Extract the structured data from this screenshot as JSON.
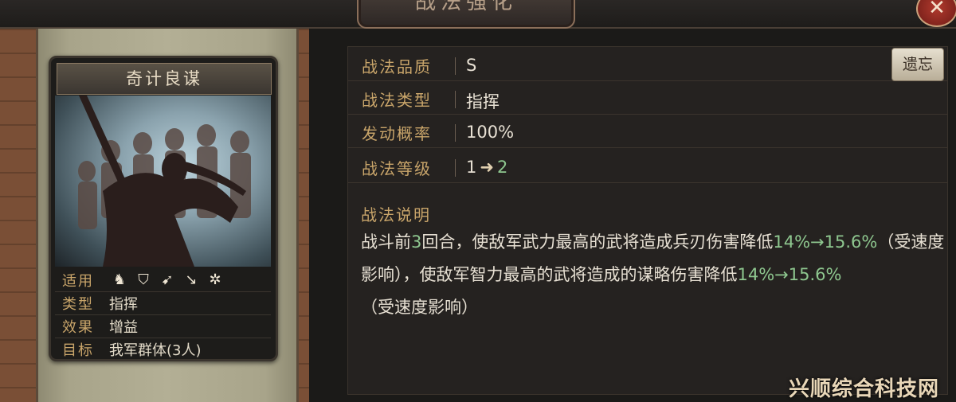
{
  "window": {
    "title": "战法强化"
  },
  "card": {
    "name": "奇计良谋",
    "attrs": {
      "suit_label": "适用",
      "type_label": "类型",
      "type_value": "指挥",
      "effect_label": "效果",
      "effect_value": "增益",
      "target_label": "目标",
      "target_value": "我军群体(3人)"
    },
    "unit_icons": [
      "cavalry-icon",
      "shield-icon",
      "bow-icon",
      "spear-icon",
      "wheel-icon"
    ]
  },
  "props": [
    {
      "key": "战法品质",
      "value": "S"
    },
    {
      "key": "战法类型",
      "value": "指挥"
    },
    {
      "key": "发动概率",
      "value": "100%"
    },
    {
      "key": "战法等级",
      "from": "1",
      "to": "2"
    }
  ],
  "reselect_label": "遗忘",
  "description": {
    "title": "战法说明",
    "p1": "战斗前",
    "n1": "3",
    "p2": "回合，使敌军武力最高的武将造成兵刃伤害降低",
    "n2": "14%→15.6%",
    "p3": "（受速度影响），使敌军智力最高的武将造成的谋略伤害降低",
    "n3": "14%→15.6%",
    "p4": "（受速度影响）"
  },
  "watermark": "兴顺综合科技网",
  "colors": {
    "gold": "#c9a56a",
    "green": "#8ec78f",
    "panel": "#252220"
  }
}
